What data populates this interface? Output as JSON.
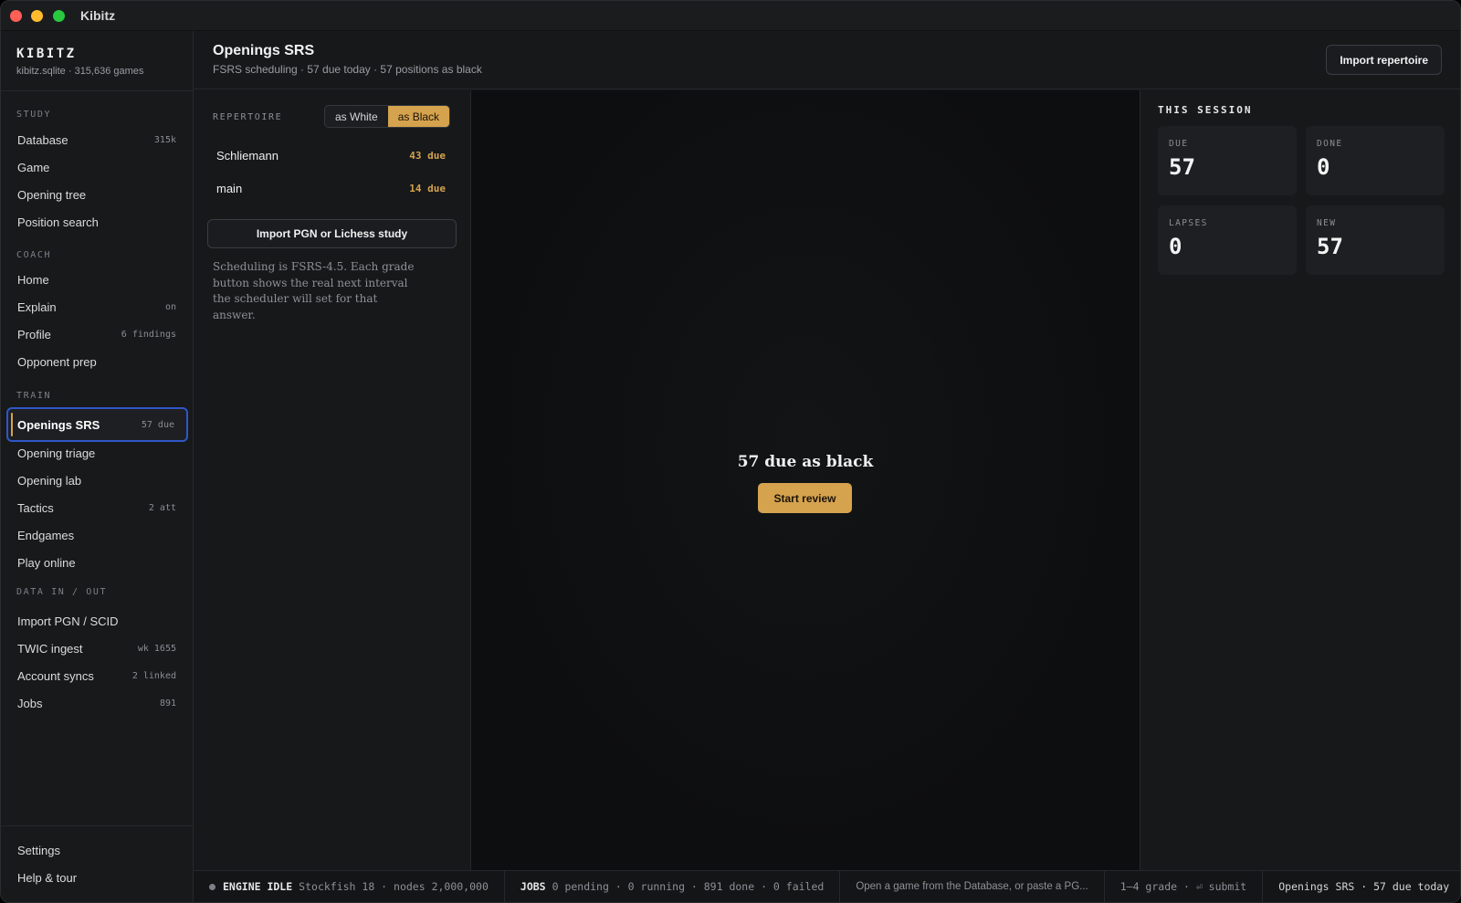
{
  "window": {
    "title": "Kibitz"
  },
  "sidebar": {
    "brand": "KIBITZ",
    "brand_sub": "kibitz.sqlite · 315,636 games",
    "sections": {
      "study": "STUDY",
      "coach": "COACH",
      "train": "TRAIN",
      "data": "DATA IN / OUT"
    },
    "items": {
      "database": {
        "label": "Database",
        "badge": "315k"
      },
      "game": {
        "label": "Game"
      },
      "opening_tree": {
        "label": "Opening tree"
      },
      "position_search": {
        "label": "Position search"
      },
      "home": {
        "label": "Home"
      },
      "explain": {
        "label": "Explain",
        "badge": "on"
      },
      "profile": {
        "label": "Profile",
        "badge": "6 findings"
      },
      "opponent_prep": {
        "label": "Opponent prep"
      },
      "openings_srs": {
        "label": "Openings SRS",
        "badge": "57 due"
      },
      "opening_triage": {
        "label": "Opening triage"
      },
      "opening_lab": {
        "label": "Opening lab"
      },
      "tactics": {
        "label": "Tactics",
        "badge": "2 att"
      },
      "endgames": {
        "label": "Endgames"
      },
      "play_online": {
        "label": "Play online"
      },
      "import_pgn": {
        "label": "Import PGN / SCID"
      },
      "twic": {
        "label": "TWIC ingest",
        "badge": "wk 1655"
      },
      "account_syncs": {
        "label": "Account syncs",
        "badge": "2 linked"
      },
      "jobs": {
        "label": "Jobs",
        "badge": "891"
      }
    },
    "settings": "Settings",
    "help": "Help & tour"
  },
  "header": {
    "title": "Openings SRS",
    "subtitle": "FSRS scheduling · 57 due today · 57 positions as black",
    "import_button": "Import repertoire"
  },
  "repertoire": {
    "label": "REPERTOIRE",
    "toggle": {
      "white": "as White",
      "black": "as Black",
      "selected": "black"
    },
    "rows": [
      {
        "name": "Schliemann",
        "due": "43 due"
      },
      {
        "name": "main",
        "due": "14 due"
      }
    ],
    "import_button": "Import PGN or Lichess study",
    "note": "Scheduling is FSRS-4.5. Each grade button shows the real next interval the scheduler will set for that answer."
  },
  "center": {
    "title": "57 due as black",
    "start_button": "Start review"
  },
  "session": {
    "title": "THIS SESSION",
    "stats": {
      "due": {
        "label": "DUE",
        "value": "57"
      },
      "done": {
        "label": "DONE",
        "value": "0"
      },
      "lapses": {
        "label": "LAPSES",
        "value": "0"
      },
      "new": {
        "label": "NEW",
        "value": "57"
      }
    }
  },
  "statusbar": {
    "engine_label": "ENGINE IDLE",
    "engine_detail": "Stockfish 18 · nodes 2,000,000",
    "jobs_label": "JOBS",
    "jobs_detail": "0 pending · 0 running · 891 done · 0 failed",
    "hint": "Open a game from the Database, or paste a PG...",
    "keys": "1–4 grade · ⏎ submit",
    "context": "Openings SRS · 57 due today"
  },
  "colors": {
    "accent": "#d5a24e",
    "focus": "#2f56c8",
    "background": "#141618"
  }
}
